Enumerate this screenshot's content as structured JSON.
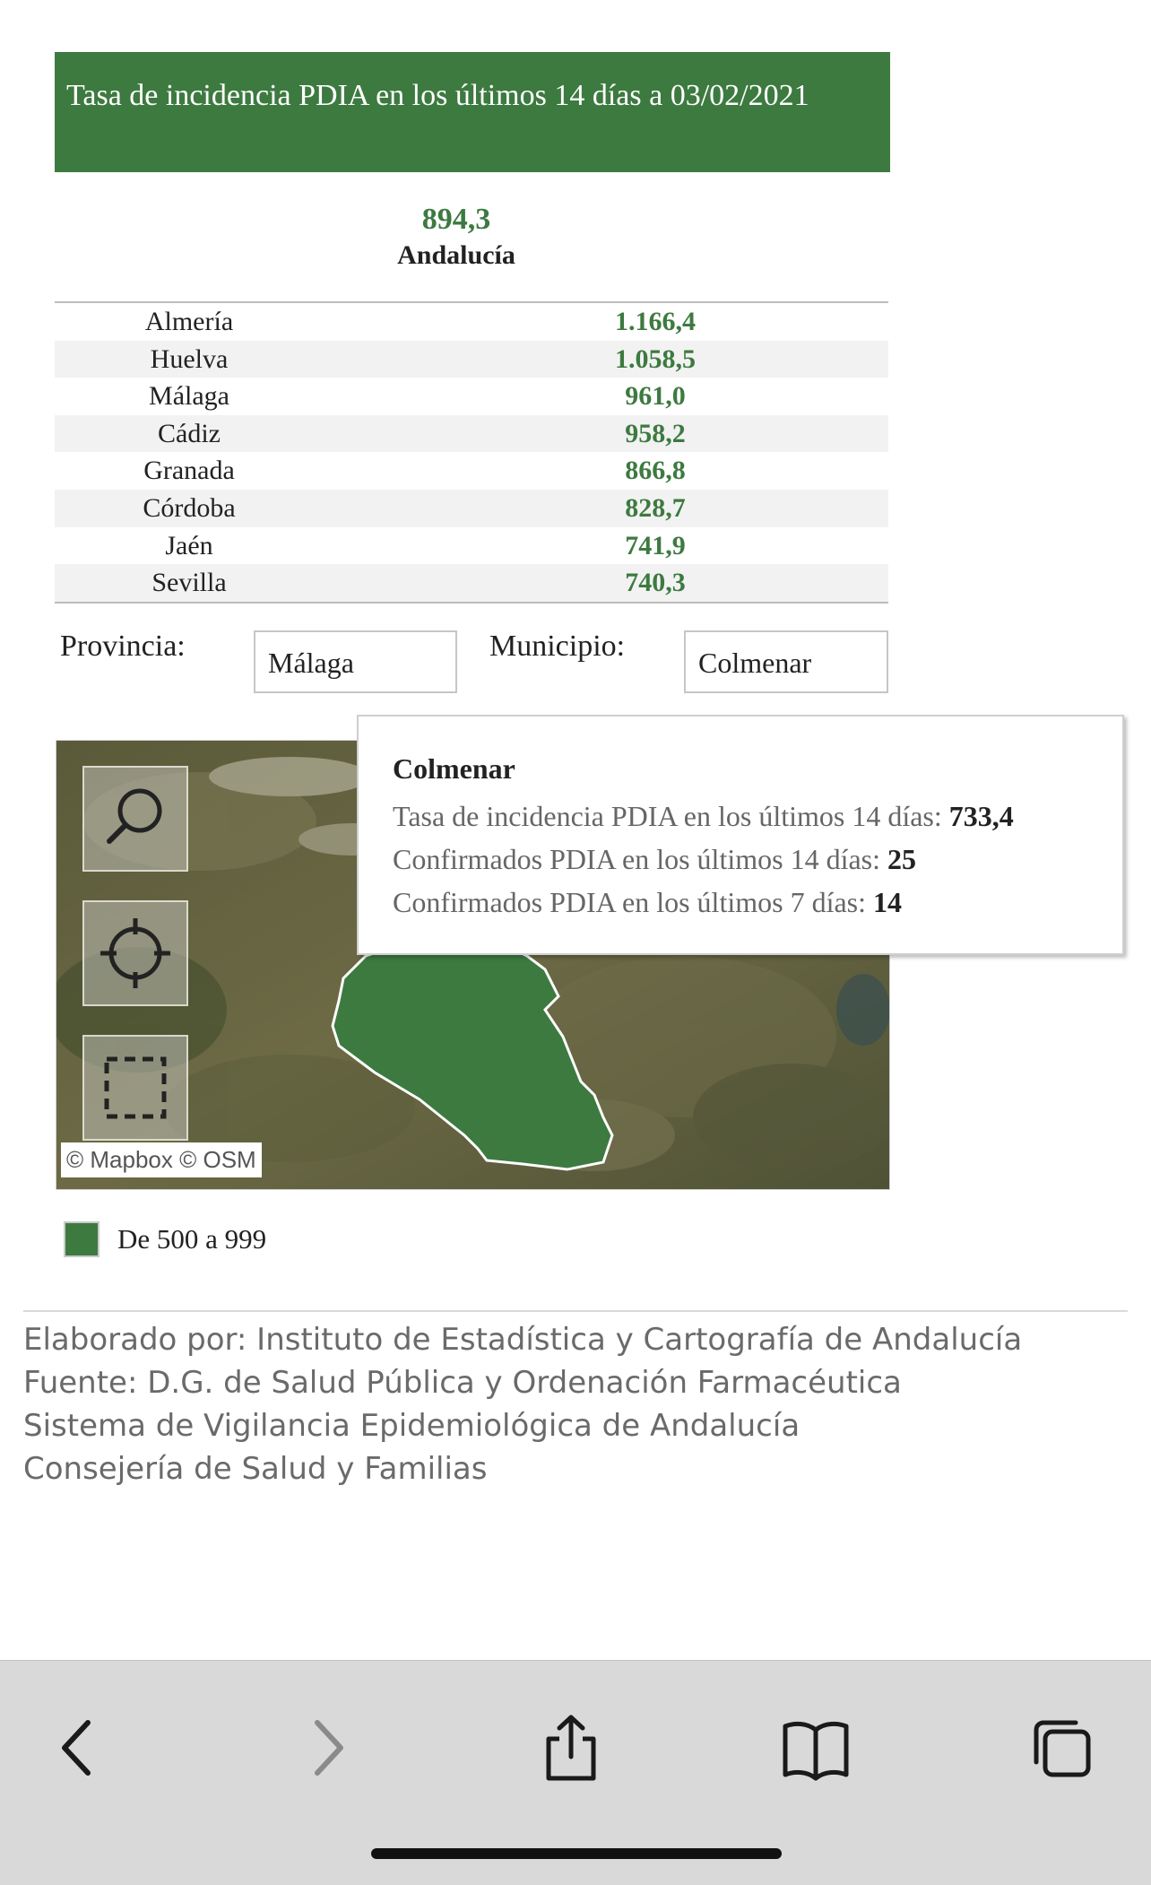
{
  "header": {
    "title": "Tasa de incidencia PDIA en los últimos 14 días a 03/02/2021"
  },
  "total": {
    "value": "894,3",
    "label": "Andalucía"
  },
  "ranking": [
    {
      "province": "Almería",
      "value": "1.166,4"
    },
    {
      "province": "Huelva",
      "value": "1.058,5"
    },
    {
      "province": "Málaga",
      "value": "961,0"
    },
    {
      "province": "Cádiz",
      "value": "958,2"
    },
    {
      "province": "Granada",
      "value": "866,8"
    },
    {
      "province": "Córdoba",
      "value": "828,7"
    },
    {
      "province": "Jaén",
      "value": "741,9"
    },
    {
      "province": "Sevilla",
      "value": "740,3"
    }
  ],
  "filters": {
    "province_label": "Provincia:",
    "province_value": "Málaga",
    "municipality_label": "Municipio:",
    "municipality_value": "Colmenar"
  },
  "map": {
    "attribution": "© Mapbox  © OSM",
    "tools": [
      "search-icon",
      "locate-icon",
      "select-area-icon"
    ],
    "highlight_color": "#3d7a40"
  },
  "tooltip": {
    "title": "Colmenar",
    "lines": [
      {
        "label": "Tasa de incidencia PDIA en los últimos 14 días: ",
        "value": "733,4"
      },
      {
        "label": "Confirmados PDIA en los últimos 14 días: ",
        "value": "25"
      },
      {
        "label": "Confirmados PDIA en los últimos 7 días: ",
        "value": "14"
      }
    ]
  },
  "legend": {
    "label": "De 500 a 999",
    "color": "#3d7a40"
  },
  "footer": {
    "lines": [
      "Elaborado por: Instituto de Estadística y Cartografía de Andalucía",
      "Fuente: D.G. de Salud Pública y Ordenación Farmacéutica",
      "Sistema de Vigilancia Epidemiológica de Andalucía",
      "Consejería de Salud y Familias"
    ]
  },
  "browser_toolbar": {
    "icons": [
      "back-icon",
      "forward-icon",
      "share-icon",
      "bookmarks-icon",
      "tabs-icon"
    ]
  }
}
